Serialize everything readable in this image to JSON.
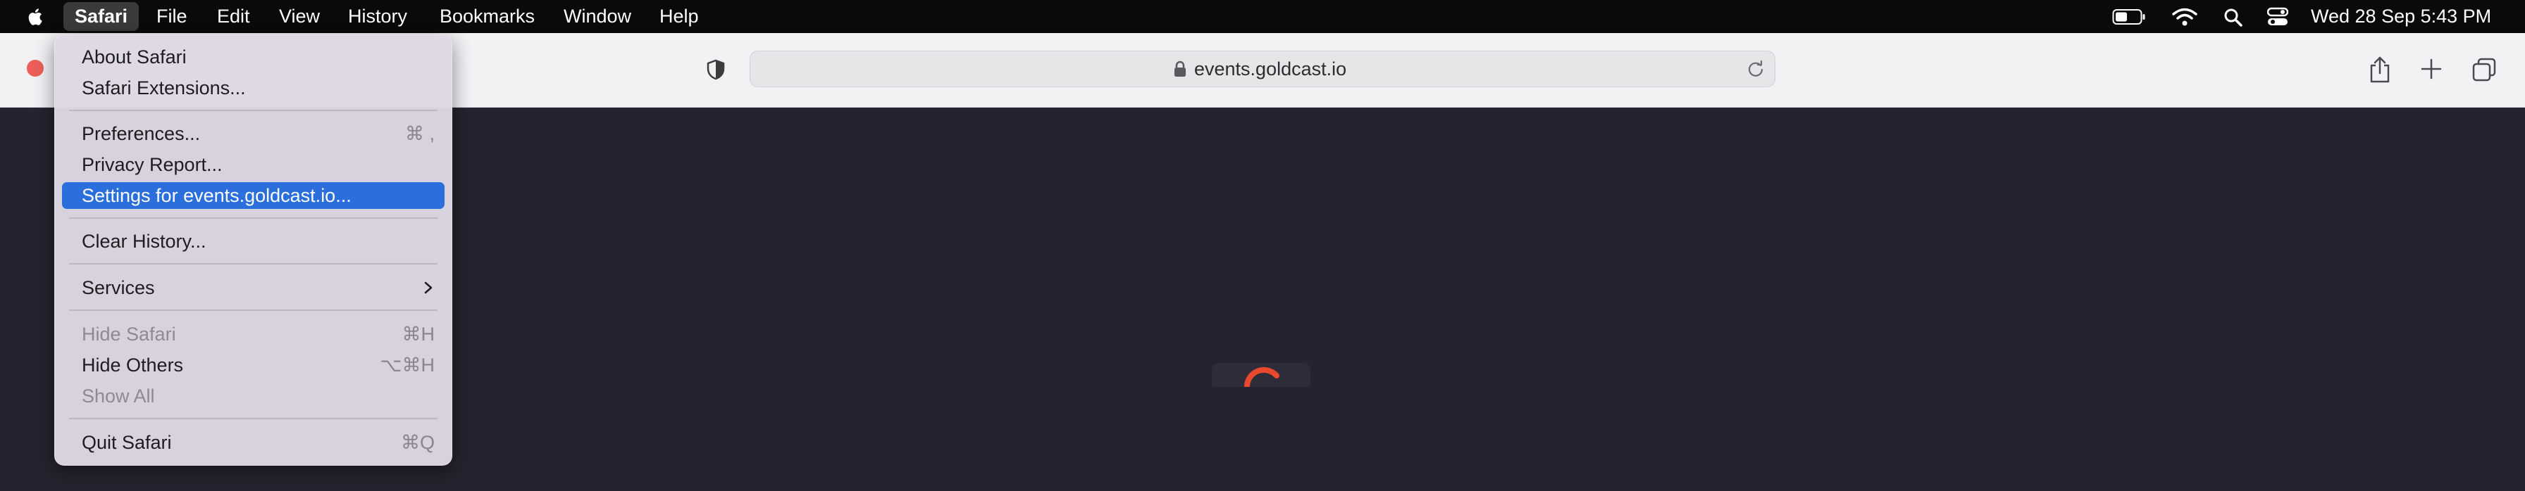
{
  "menubar": {
    "items": [
      "Safari",
      "File",
      "Edit",
      "View",
      "History",
      "Bookmarks",
      "Window",
      "Help"
    ],
    "active_index": 0,
    "status": {
      "datetime": "Wed 28 Sep  5:43 PM",
      "icons": [
        "battery-icon",
        "wifi-icon",
        "search-icon",
        "control-center-icon"
      ]
    }
  },
  "toolbar": {
    "url": "events.goldcast.io",
    "icons": [
      "shield-icon",
      "lock-icon",
      "reload-icon",
      "share-icon",
      "new-tab-icon",
      "tab-overview-icon"
    ]
  },
  "safari_menu": {
    "items": [
      {
        "label": "About Safari",
        "shortcut": ""
      },
      {
        "label": "Safari Extensions...",
        "shortcut": ""
      },
      {
        "label": "Preferences...",
        "shortcut": "⌘ ,"
      },
      {
        "label": "Privacy Report...",
        "shortcut": ""
      },
      {
        "label": "Settings for events.goldcast.io...",
        "shortcut": "",
        "highlighted": true
      },
      {
        "label": "Clear History...",
        "shortcut": ""
      },
      {
        "label": "Services",
        "shortcut": "",
        "submenu": true
      },
      {
        "label": "Hide Safari",
        "shortcut": "⌘H",
        "disabled": true
      },
      {
        "label": "Hide Others",
        "shortcut": "⌥⌘H"
      },
      {
        "label": "Show All",
        "shortcut": "",
        "disabled": true
      },
      {
        "label": "Quit Safari",
        "shortcut": "⌘Q"
      }
    ]
  },
  "colors": {
    "menubar_bg": "#0a0a0a",
    "toolbar_bg": "#f2f1f4",
    "content_bg": "#25232f",
    "menu_bg": "#ded7e4",
    "highlight": "#2a6fdb",
    "spinner_accent": "#e8492f"
  }
}
